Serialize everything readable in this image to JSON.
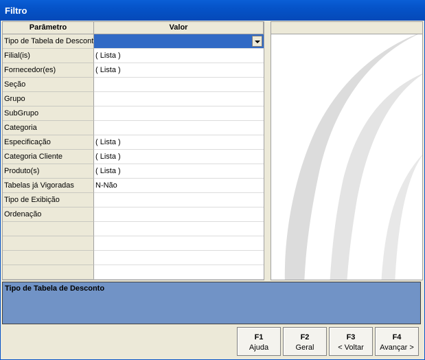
{
  "window": {
    "title": "Filtro"
  },
  "grid": {
    "col_param": "Parâmetro",
    "col_value": "Valor",
    "rows": [
      {
        "param": "Tipo de Tabela de Desconto",
        "value": ""
      },
      {
        "param": "Filial(is)",
        "value": "( Lista )"
      },
      {
        "param": "Fornecedor(es)",
        "value": "( Lista )"
      },
      {
        "param": "Seção",
        "value": ""
      },
      {
        "param": "Grupo",
        "value": ""
      },
      {
        "param": "SubGrupo",
        "value": ""
      },
      {
        "param": "Categoria",
        "value": ""
      },
      {
        "param": "Especificação",
        "value": "( Lista )"
      },
      {
        "param": "Categoria Cliente",
        "value": "( Lista )"
      },
      {
        "param": "Produto(s)",
        "value": "( Lista )"
      },
      {
        "param": "Tabelas já Vigoradas",
        "value": "N-Não"
      },
      {
        "param": "Tipo de Exibição",
        "value": ""
      },
      {
        "param": "Ordenação",
        "value": ""
      }
    ]
  },
  "description": {
    "text": "Tipo de Tabela de Desconto"
  },
  "buttons": [
    {
      "key": "F1",
      "label": "Ajuda"
    },
    {
      "key": "F2",
      "label": "Geral"
    },
    {
      "key": "F3",
      "label": "< Voltar"
    },
    {
      "key": "F4",
      "label": "Avançar >"
    }
  ],
  "colors": {
    "title_bar": "#0553c8",
    "selection": "#316ac5",
    "description_bg": "#7193c6",
    "panel": "#ece9d8"
  }
}
